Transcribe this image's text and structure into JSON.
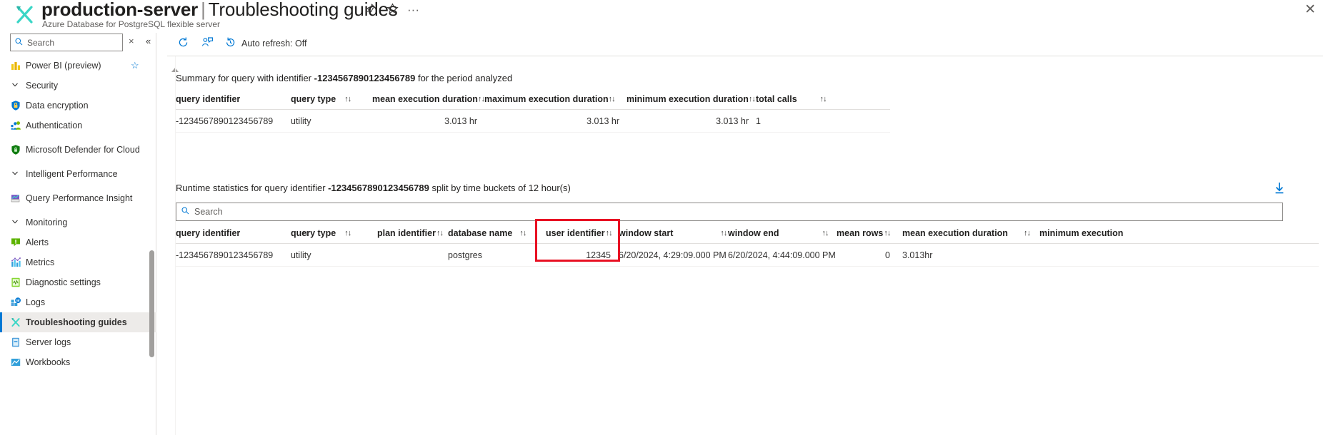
{
  "header": {
    "resource_name": "production-server",
    "separator": "|",
    "page_name": "Troubleshooting guides",
    "subtitle": "Azure Database for PostgreSQL flexible server",
    "icon": "troubleshoot-wrench-icon",
    "pin_label": "☆",
    "favorite_label": "☆",
    "more_label": "···",
    "close_label": "✕"
  },
  "left_nav": {
    "search": {
      "placeholder": "Search",
      "icon": "search-icon"
    },
    "clear_label": "×",
    "collapse_label": "«",
    "items": [
      {
        "label": "Power BI (preview)",
        "icon": "power-bi-icon",
        "type": "item",
        "favorited": true,
        "star": "☆"
      },
      {
        "label": "Security",
        "icon": "chevron-down-icon",
        "type": "group",
        "chev": "⌄"
      },
      {
        "label": "Data encryption",
        "icon": "lock-shield-icon",
        "type": "item"
      },
      {
        "label": "Authentication",
        "icon": "authentication-icon",
        "type": "item"
      },
      {
        "label": "Microsoft Defender for Cloud",
        "icon": "defender-shield-icon",
        "type": "item2"
      },
      {
        "label": "Intelligent Performance",
        "icon": "chevron-down-icon",
        "type": "group",
        "chev": "⌄"
      },
      {
        "label": "Query Performance Insight",
        "icon": "query-performance-icon",
        "type": "item2"
      },
      {
        "label": "Monitoring",
        "icon": "chevron-down-icon",
        "type": "group",
        "chev": "⌄"
      },
      {
        "label": "Alerts",
        "icon": "alerts-icon",
        "type": "item"
      },
      {
        "label": "Metrics",
        "icon": "metrics-icon",
        "type": "item"
      },
      {
        "label": "Diagnostic settings",
        "icon": "diagnostic-settings-icon",
        "type": "item"
      },
      {
        "label": "Logs",
        "icon": "logs-icon",
        "type": "item"
      },
      {
        "label": "Troubleshooting guides",
        "icon": "troubleshoot-wrench-icon",
        "type": "item",
        "selected": true
      },
      {
        "label": "Server logs",
        "icon": "server-logs-icon",
        "type": "item"
      },
      {
        "label": "Workbooks",
        "icon": "workbooks-icon",
        "type": "item"
      }
    ]
  },
  "toolbar": {
    "refresh": {
      "label": "",
      "icon": "refresh-icon"
    },
    "feedback": {
      "label": "",
      "icon": "feedback-person-icon"
    },
    "auto_refresh": {
      "label": "Auto refresh: Off",
      "icon": "clock-history-icon"
    }
  },
  "summary_section": {
    "title_prefix": "Summary for query with identifier",
    "title_identifier": "-1234567890123456789",
    "title_suffix": "for the period analyzed",
    "sorter": "↑↓",
    "columns": [
      "query identifier",
      "query type",
      "mean execution duration",
      "maximum execution duration",
      "minimum execution duration",
      "total calls"
    ],
    "rows": [
      {
        "query_identifier": "-1234567890123456789",
        "query_type": "utility",
        "mean_execution_duration": "3.013 hr",
        "maximum_execution_duration": "3.013 hr",
        "minimum_execution_duration": "3.013 hr",
        "total_calls": "1"
      }
    ]
  },
  "runtime_section": {
    "title_prefix": "Runtime statistics for query identifier",
    "title_identifier": "-1234567890123456789",
    "title_suffix": "split by time buckets of 12 hour(s)",
    "download": {
      "icon": "download-icon"
    },
    "search": {
      "placeholder": "Search",
      "icon": "search-icon"
    },
    "sorter": "↑↓",
    "columns": [
      "query identifier",
      "query type",
      "plan identifier",
      "database name",
      "user identifier",
      "window start",
      "window end",
      "mean rows",
      "mean execution duration",
      "minimum execution"
    ],
    "rows": [
      {
        "query_identifier": "-1234567890123456789",
        "query_type": "utility",
        "plan_identifier": "",
        "database_name": "postgres",
        "user_identifier": "12345",
        "window_start": "6/20/2024, 4:29:09.000 PM",
        "window_end": "6/20/2024, 4:44:09.000 PM",
        "mean_rows": "0",
        "mean_execution_duration": "3.013hr",
        "minimum_execution": ""
      }
    ],
    "highlight": {
      "name": "user-identifier-column-highlight",
      "color": "#e81123"
    }
  }
}
